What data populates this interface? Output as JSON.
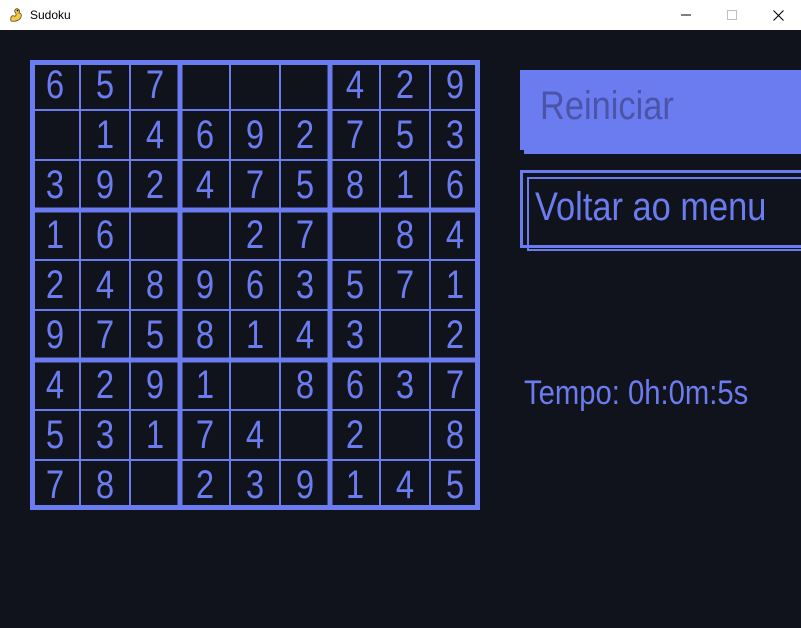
{
  "window": {
    "title": "Sudoku",
    "icon": "pygame-snake-icon",
    "controls": [
      "minimize-icon",
      "maximize-icon",
      "close-icon"
    ]
  },
  "colors": {
    "background": "#10121c",
    "accent": "#6b7cf0",
    "reset_label": "#4a55a8"
  },
  "board": {
    "rows": [
      [
        "6",
        "5",
        "7",
        "",
        "",
        "",
        "4",
        "2",
        "9"
      ],
      [
        "",
        "1",
        "4",
        "6",
        "9",
        "2",
        "7",
        "5",
        "3"
      ],
      [
        "3",
        "9",
        "2",
        "4",
        "7",
        "5",
        "8",
        "1",
        "6"
      ],
      [
        "1",
        "6",
        "",
        "",
        "2",
        "7",
        "",
        "8",
        "4"
      ],
      [
        "2",
        "4",
        "8",
        "9",
        "6",
        "3",
        "5",
        "7",
        "1"
      ],
      [
        "9",
        "7",
        "5",
        "8",
        "1",
        "4",
        "3",
        "",
        "2"
      ],
      [
        "4",
        "2",
        "9",
        "1",
        "",
        "8",
        "6",
        "3",
        "7"
      ],
      [
        "5",
        "3",
        "1",
        "7",
        "4",
        "",
        "2",
        "",
        "8"
      ],
      [
        "7",
        "8",
        "",
        "2",
        "3",
        "9",
        "1",
        "4",
        "5"
      ]
    ]
  },
  "buttons": {
    "reset_label": "Reiniciar",
    "menu_label": "Voltar ao menu"
  },
  "timer": {
    "text": "Tempo: 0h:0m:5s"
  }
}
